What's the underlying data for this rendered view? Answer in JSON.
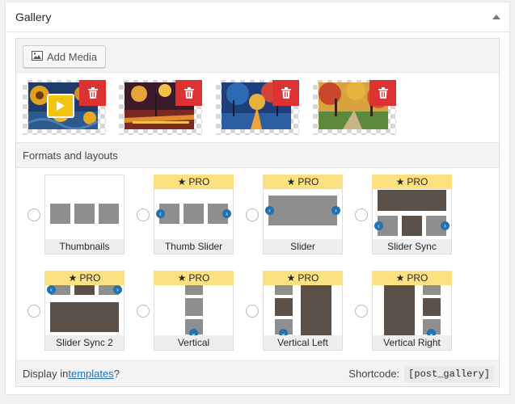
{
  "box": {
    "title": "Gallery"
  },
  "toolbar": {
    "add_media_label": "Add Media"
  },
  "images": [
    {
      "name": "Sunflowers painting"
    },
    {
      "name": "Street at night painting"
    },
    {
      "name": "Blue park painting"
    },
    {
      "name": "Autumn alley painting"
    }
  ],
  "formats": {
    "heading": "Formats and layouts",
    "pro_label": "PRO",
    "options": [
      {
        "label": "Thumbnails"
      },
      {
        "label": "Thumb Slider"
      },
      {
        "label": "Slider"
      },
      {
        "label": "Slider Sync"
      },
      {
        "label": "Slider Sync 2"
      },
      {
        "label": "Vertical"
      },
      {
        "label": "Vertical Left"
      },
      {
        "label": "Vertical Right"
      }
    ]
  },
  "footer": {
    "display_in": "Display in ",
    "templates_link": "templates",
    "question": "?",
    "shortcode_label": "Shortcode:",
    "shortcode_value": "[post_gallery]"
  },
  "colors": {
    "delete": "#dc3232",
    "pro": "#fde181",
    "accent": "#2271b1",
    "play": "#f1c40f"
  }
}
